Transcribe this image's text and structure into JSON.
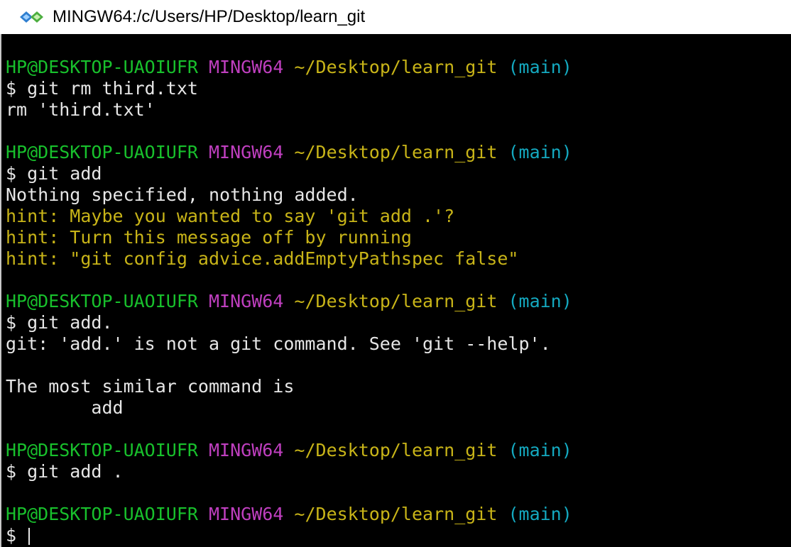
{
  "window": {
    "title": "MINGW64:/c/Users/HP/Desktop/learn_git",
    "icon": "mingw-diamond-icon"
  },
  "colors": {
    "background": "#000000",
    "user": "#18c02c",
    "host": "#bf3fbf",
    "path": "#c8b418",
    "branch": "#14a9c0",
    "hint": "#c8b418",
    "output": "#e6e6e6"
  },
  "terminal": {
    "blocks": [
      {
        "prompt": {
          "user": "HP@DESKTOP-UAOIUFR",
          "host": "MINGW64",
          "path": "~/Desktop/learn_git",
          "branch": "(main)"
        },
        "command": "$ git rm third.txt",
        "output": [
          "rm 'third.txt'"
        ],
        "hints": []
      },
      {
        "prompt": {
          "user": "HP@DESKTOP-UAOIUFR",
          "host": "MINGW64",
          "path": "~/Desktop/learn_git",
          "branch": "(main)"
        },
        "command": "$ git add",
        "output": [
          "Nothing specified, nothing added."
        ],
        "hints": [
          "hint: Maybe you wanted to say 'git add .'?",
          "hint: Turn this message off by running",
          "hint: \"git config advice.addEmptyPathspec false\""
        ]
      },
      {
        "prompt": {
          "user": "HP@DESKTOP-UAOIUFR",
          "host": "MINGW64",
          "path": "~/Desktop/learn_git",
          "branch": "(main)"
        },
        "command": "$ git add.",
        "output": [
          "git: 'add.' is not a git command. See 'git --help'.",
          "",
          "The most similar command is",
          "        add"
        ],
        "hints": []
      },
      {
        "prompt": {
          "user": "HP@DESKTOP-UAOIUFR",
          "host": "MINGW64",
          "path": "~/Desktop/learn_git",
          "branch": "(main)"
        },
        "command": "$ git add .",
        "output": [],
        "hints": []
      },
      {
        "prompt": {
          "user": "HP@DESKTOP-UAOIUFR",
          "host": "MINGW64",
          "path": "~/Desktop/learn_git",
          "branch": "(main)"
        },
        "command": "$ ",
        "output": [],
        "hints": [],
        "cursor": true
      }
    ]
  }
}
